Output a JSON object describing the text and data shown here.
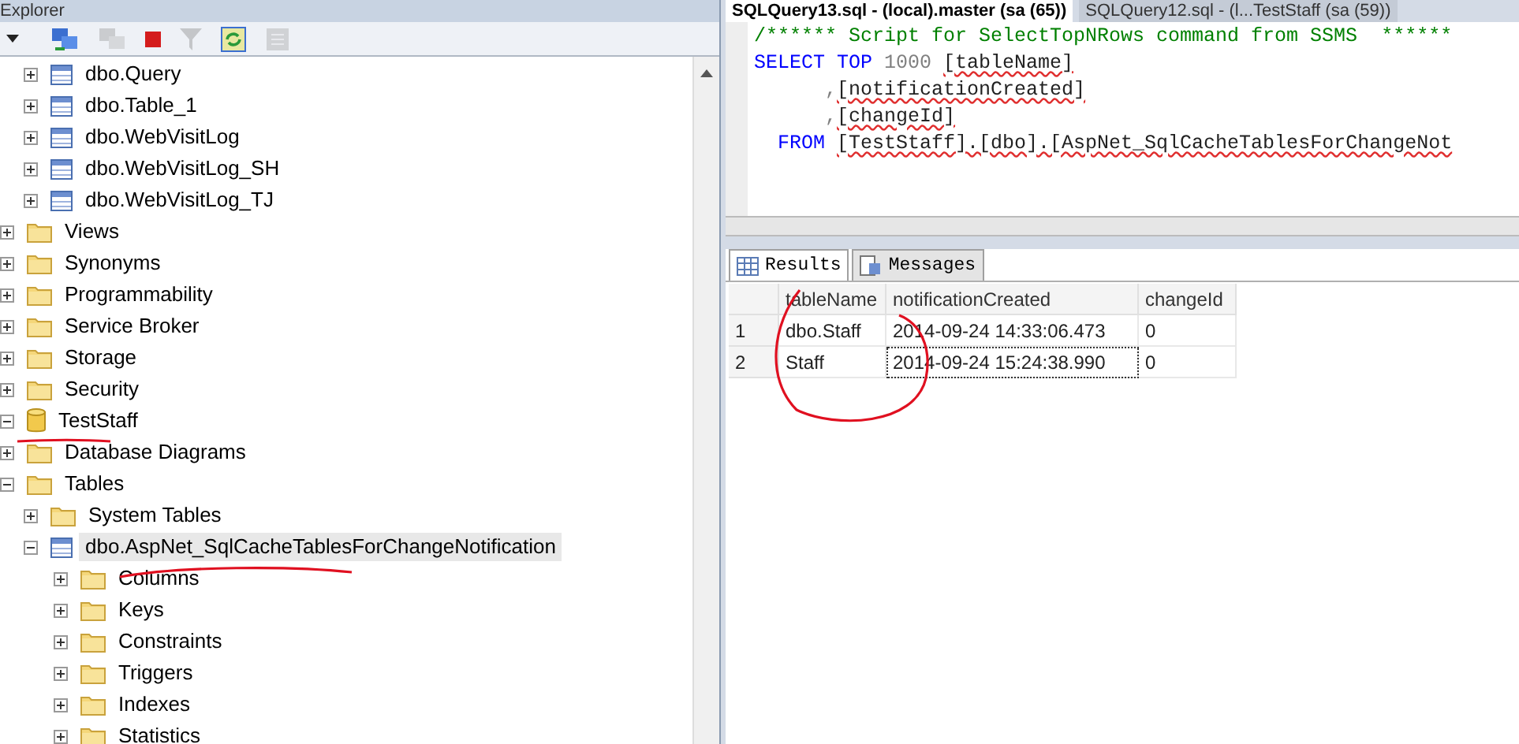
{
  "explorer": {
    "title": "Explorer",
    "toolbar": [
      {
        "kind": "dropdown",
        "disabled": false
      },
      {
        "kind": "connect",
        "disabled": false
      },
      {
        "kind": "disconnect",
        "disabled": true
      },
      {
        "kind": "stop",
        "disabled": false
      },
      {
        "kind": "filter",
        "disabled": true
      },
      {
        "kind": "refresh",
        "disabled": false
      },
      {
        "kind": "summary",
        "disabled": true
      }
    ],
    "tree": [
      {
        "children": [
          {
            "children": [
              {
                "label": "dbo.Query",
                "kind": "table",
                "expanded": false,
                "selected": false
              },
              {
                "label": "dbo.Table_1",
                "kind": "table",
                "expanded": false,
                "selected": false
              },
              {
                "label": "dbo.WebVisitLog",
                "kind": "table",
                "expanded": false,
                "selected": false
              },
              {
                "label": "dbo.WebVisitLog_SH",
                "kind": "table",
                "expanded": false,
                "selected": false
              },
              {
                "label": "dbo.WebVisitLog_TJ",
                "kind": "table",
                "expanded": false,
                "selected": false
              }
            ]
          },
          {
            "label": "Views",
            "kind": "folder",
            "expanded": false,
            "selected": false
          },
          {
            "label": "Synonyms",
            "kind": "folder",
            "expanded": false,
            "selected": false
          },
          {
            "label": "Programmability",
            "kind": "folder",
            "expanded": false,
            "selected": false
          },
          {
            "label": "Service Broker",
            "kind": "folder",
            "expanded": false,
            "selected": false
          },
          {
            "label": "Storage",
            "kind": "folder",
            "expanded": false,
            "selected": false
          },
          {
            "label": "Security",
            "kind": "folder",
            "expanded": false,
            "selected": false
          }
        ]
      },
      {
        "label": "TestStaff",
        "kind": "database",
        "expanded": true,
        "selected": false,
        "children": [
          {
            "label": "Database Diagrams",
            "kind": "folder",
            "expanded": false,
            "selected": false
          },
          {
            "label": "Tables",
            "kind": "folder",
            "expanded": true,
            "selected": false,
            "children": [
              {
                "label": "System Tables",
                "kind": "folder",
                "expanded": false,
                "selected": false
              },
              {
                "label": "dbo.AspNet_SqlCacheTablesForChangeNotification",
                "kind": "table",
                "expanded": true,
                "selected": true,
                "children": [
                  {
                    "label": "Columns",
                    "kind": "folder",
                    "expanded": false,
                    "selected": false
                  },
                  {
                    "label": "Keys",
                    "kind": "folder",
                    "expanded": false,
                    "selected": false
                  },
                  {
                    "label": "Constraints",
                    "kind": "folder",
                    "expanded": false,
                    "selected": false
                  },
                  {
                    "label": "Triggers",
                    "kind": "folder",
                    "expanded": false,
                    "selected": false
                  },
                  {
                    "label": "Indexes",
                    "kind": "folder",
                    "expanded": false,
                    "selected": false
                  },
                  {
                    "label": "Statistics",
                    "kind": "folder",
                    "expanded": false,
                    "selected": false
                  }
                ]
              }
            ]
          }
        ]
      }
    ]
  },
  "editor_tabs": [
    {
      "label": "SQLQuery13.sql - (local).master (sa (65))",
      "selected": true
    },
    {
      "label": "SQLQuery12.sql - (l...TestStaff (sa (59))",
      "selected": false
    }
  ],
  "editor": {
    "lines": [
      [
        {
          "kind": "comment",
          "text": "/****** Script for SelectTopNRows command from SSMS  ******"
        }
      ],
      [
        {
          "kind": "keyword",
          "text": "SELECT TOP "
        },
        {
          "kind": "plain",
          "text": "1000 "
        },
        {
          "kind": "ident",
          "text": "[tableName]"
        }
      ],
      [
        {
          "kind": "plain",
          "text": "      ,"
        },
        {
          "kind": "ident",
          "text": "[notificationCreated]"
        }
      ],
      [
        {
          "kind": "plain",
          "text": "      ,"
        },
        {
          "kind": "ident",
          "text": "[changeId]"
        }
      ],
      [
        {
          "kind": "keyword",
          "text": "  FROM "
        },
        {
          "kind": "ident",
          "text": "[TestStaff].[dbo].[AspNet_SqlCacheTablesForChangeNot"
        }
      ]
    ]
  },
  "result_tabs": [
    {
      "label": "Results",
      "kind": "grid",
      "selected": true
    },
    {
      "label": "Messages",
      "kind": "messages",
      "selected": false
    }
  ],
  "grid": {
    "columns": [
      "tableName",
      "notificationCreated",
      "changeId"
    ],
    "rows": [
      {
        "number": "1",
        "cells": [
          {
            "text": "dbo.Staff",
            "focused": false
          },
          {
            "text": "2014-09-24 14:33:06.473",
            "focused": false
          },
          {
            "text": "0",
            "focused": false
          }
        ]
      },
      {
        "number": "2",
        "cells": [
          {
            "text": "Staff",
            "focused": false
          },
          {
            "text": "2014-09-24 15:24:38.990",
            "focused": true
          },
          {
            "text": "0",
            "focused": false
          }
        ]
      }
    ]
  }
}
